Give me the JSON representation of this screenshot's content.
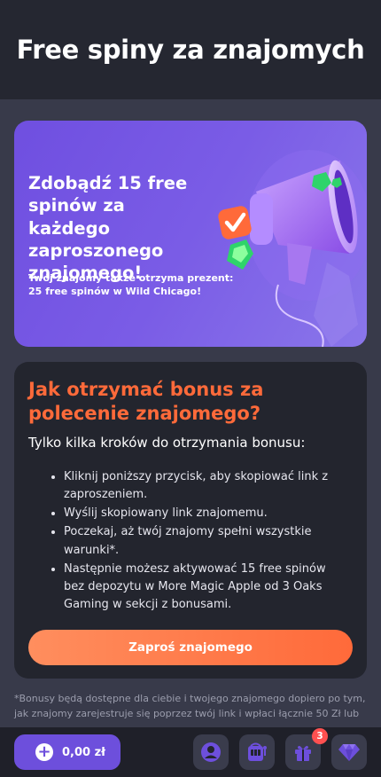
{
  "header": {
    "title": "Free spiny za znajomych"
  },
  "hero": {
    "title": "Zdobądź 15 free spinów za każdego zaproszonego znajomego!",
    "subtitle": "Twój znajomy także otrzyma prezent: 25 free spinów w Wild Chicago!"
  },
  "how_to": {
    "heading": "Jak otrzymać bonus za polecenie znajomego?",
    "lead": "Tylko kilka kroków do otrzymania bonusu:",
    "steps": [
      "Kliknij poniższy przycisk, aby skopiować link z zaproszeniem.",
      "Wyślij skopiowany link znajomemu.",
      "Poczekaj, aż twój znajomy spełni wszystkie warunki*.",
      "Następnie możesz aktywować 15 free spinów bez depozytu w More Magic Apple od 3 Oaks Gaming w sekcji z bonusami."
    ],
    "cta_label": "Zaproś znajomego"
  },
  "footnote": "*Bonusy będą dostępne dla ciebie i twojego znajomego dopiero po tym, jak znajomy zarejestruje się poprzez twój link i wpłaci łącznie 50 Zł lub",
  "bottom_bar": {
    "balance": "0,00 zł",
    "gifts_badge": "3",
    "icons": [
      "plus-icon",
      "user-icon",
      "slot-machine-icon",
      "gift-icon",
      "diamond-icon"
    ]
  },
  "colors": {
    "accent_orange": "#ff6a3a",
    "accent_purple": "#6d4fdc",
    "background": "#383a4a",
    "header_bg": "#252731",
    "card_bg": "#23252e"
  }
}
